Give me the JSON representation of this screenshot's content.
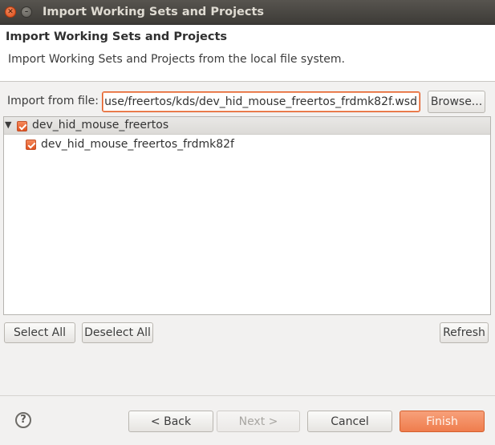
{
  "window": {
    "title": "Import Working Sets and Projects"
  },
  "header": {
    "title": "Import Working Sets and Projects",
    "description": "Import Working Sets and Projects from the local file system."
  },
  "import": {
    "label": "Import from file:",
    "value": "use/freertos/kds/dev_hid_mouse_freertos_frdmk82f.wsd",
    "browse_label": "Browse..."
  },
  "tree": {
    "items": [
      {
        "label": "dev_hid_mouse_freertos",
        "checked": true,
        "expanded": true
      },
      {
        "label": "dev_hid_mouse_freertos_frdmk82f",
        "checked": true
      }
    ]
  },
  "actions": {
    "select_all": "Select All",
    "deselect_all": "Deselect All",
    "refresh": "Refresh"
  },
  "footer": {
    "help_icon": "?",
    "back": "< Back",
    "next": "Next >",
    "cancel": "Cancel",
    "finish": "Finish"
  },
  "colors": {
    "accent": "#ef7d4d",
    "titlebar": "#3d3b37"
  }
}
